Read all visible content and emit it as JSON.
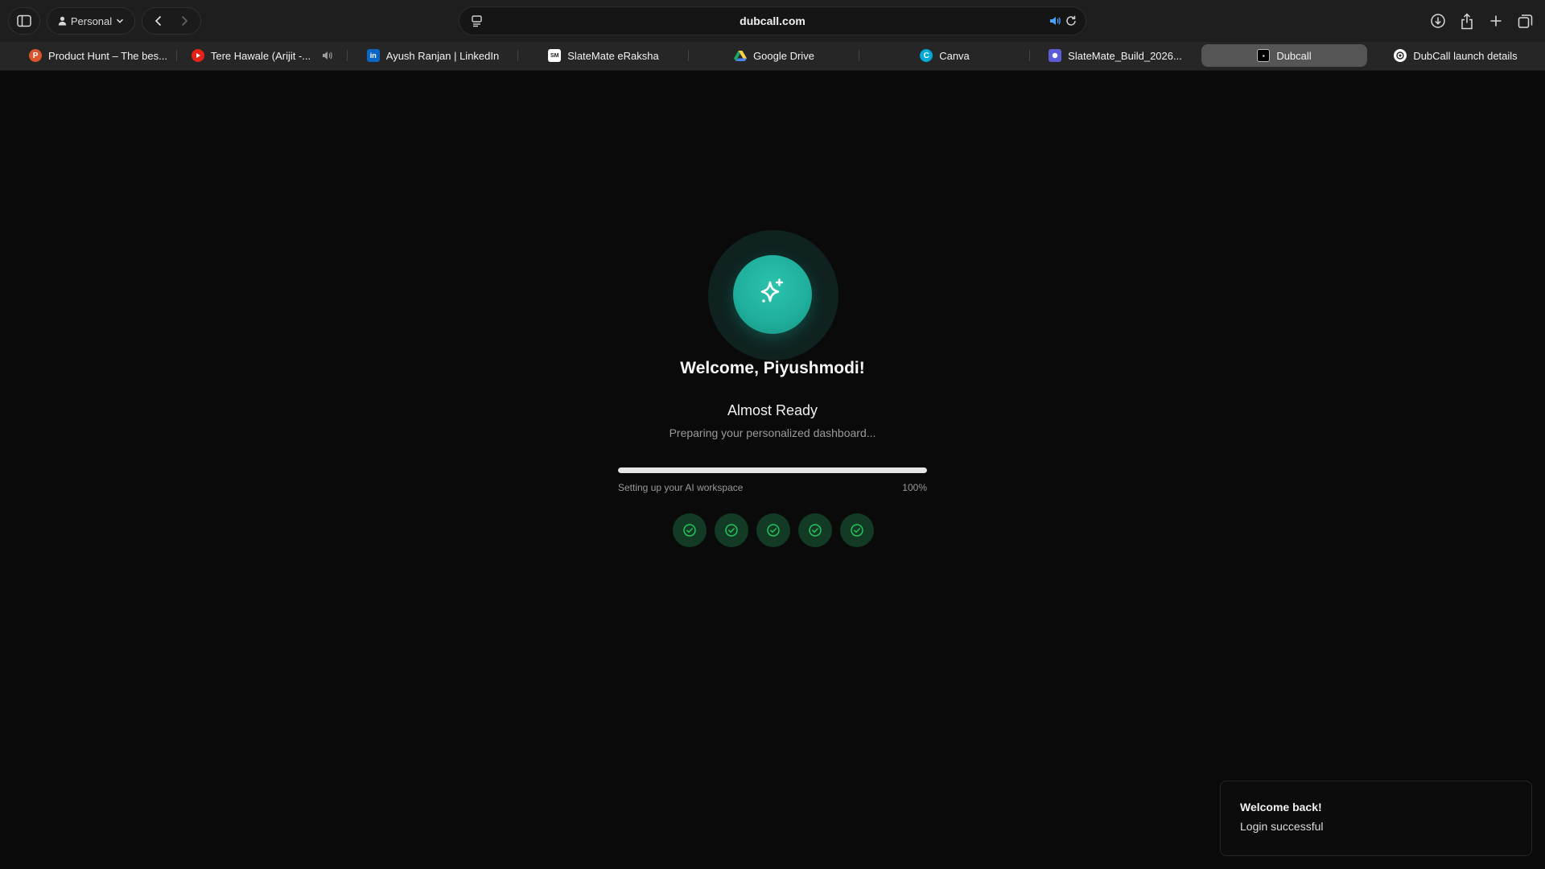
{
  "browser": {
    "profile_label": "Personal",
    "address": "dubcall.com",
    "tabs": [
      {
        "label": "Product Hunt – The bes...",
        "icon": "product-hunt-icon",
        "color": "#da552f"
      },
      {
        "label": "Tere Hawale (Arijit -...",
        "icon": "youtube-icon",
        "color": "#e62117",
        "muted_icon": "speaker-icon"
      },
      {
        "label": "Ayush Ranjan | LinkedIn",
        "icon": "linkedin-icon",
        "color": "#0a66c2"
      },
      {
        "label": "SlateMate eRaksha",
        "icon": "slatemate-icon",
        "color": "#ffffff"
      },
      {
        "label": "Google Drive",
        "icon": "google-drive-icon",
        "color": "#1fa463"
      },
      {
        "label": "Canva",
        "icon": "canva-icon",
        "color": "#00c4cc"
      },
      {
        "label": "SlateMate_Build_2026...",
        "icon": "file-icon",
        "color": "#5b5bd6"
      },
      {
        "label": "Dubcall",
        "icon": "dubcall-icon",
        "color": "#000000"
      },
      {
        "label": "DubCall launch details",
        "icon": "chatgpt-icon",
        "color": "#ffffff"
      }
    ]
  },
  "main": {
    "welcome": "Welcome, Piyushmodi!",
    "status_title": "Almost Ready",
    "status_subtitle": "Preparing your personalized dashboard...",
    "progress_label": "Setting up your AI workspace",
    "progress_percent_text": "100%",
    "progress_fraction": 1.0,
    "steps_completed": 5,
    "accent_color": "#1fae9b",
    "step_check_color": "#22c55e"
  },
  "toast": {
    "title": "Welcome back!",
    "message": "Login successful"
  }
}
